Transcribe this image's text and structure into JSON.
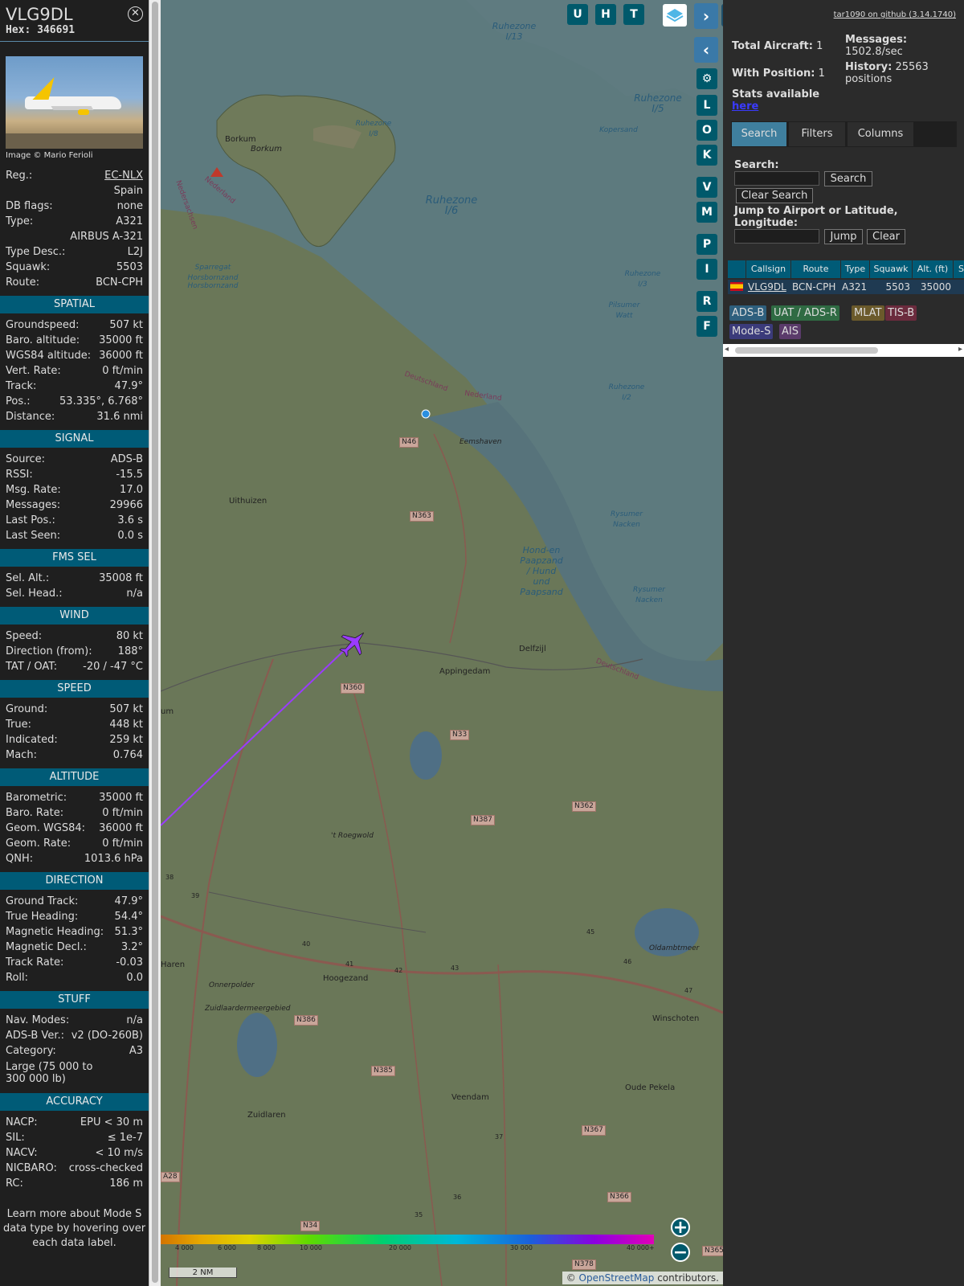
{
  "aircraft": {
    "callsign": "VLG9DL",
    "hex_label": "Hex: 346691",
    "close_glyph": "⊗",
    "image_credit": "Image © Mario Ferioli",
    "rows": [
      {
        "label": "Reg.:",
        "value": "EC-NLX",
        "sub": "Spain"
      },
      {
        "label": "DB flags:",
        "value": "none"
      },
      {
        "label": "Type:",
        "value": "A321",
        "sub": "AIRBUS A-321"
      },
      {
        "label": "Type Desc.:",
        "value": "L2J"
      },
      {
        "label": "Squawk:",
        "value": "5503"
      },
      {
        "label": "Route:",
        "value": "BCN-CPH"
      }
    ]
  },
  "sections": [
    {
      "title": "SPATIAL",
      "rows": [
        {
          "label": "Groundspeed:",
          "value": "507 kt"
        },
        {
          "label": "Baro. altitude:",
          "value": "35000 ft"
        },
        {
          "label": "WGS84 altitude:",
          "value": "36000 ft"
        },
        {
          "label": "Vert. Rate:",
          "value": "0 ft/min"
        },
        {
          "label": "Track:",
          "value": "47.9°"
        },
        {
          "label": "Pos.:",
          "value": "53.335°, 6.768°"
        },
        {
          "label": "Distance:",
          "value": "31.6 nmi"
        }
      ]
    },
    {
      "title": "SIGNAL",
      "rows": [
        {
          "label": "Source:",
          "value": "ADS-B"
        },
        {
          "label": "RSSI:",
          "value": "-15.5"
        },
        {
          "label": "Msg. Rate:",
          "value": "17.0"
        },
        {
          "label": "Messages:",
          "value": "29966"
        },
        {
          "label": "Last Pos.:",
          "value": "3.6 s"
        },
        {
          "label": "Last Seen:",
          "value": "0.0 s"
        }
      ]
    },
    {
      "title": "FMS SEL",
      "rows": [
        {
          "label": "Sel. Alt.:",
          "value": "35008 ft"
        },
        {
          "label": "Sel. Head.:",
          "value": "n/a"
        }
      ]
    },
    {
      "title": "WIND",
      "rows": [
        {
          "label": "Speed:",
          "value": "80 kt"
        },
        {
          "label": "Direction (from):",
          "value": "188°"
        },
        {
          "label": "TAT / OAT:",
          "value": "-20 / -47 °C"
        }
      ]
    },
    {
      "title": "SPEED",
      "rows": [
        {
          "label": "Ground:",
          "value": "507 kt"
        },
        {
          "label": "True:",
          "value": "448 kt"
        },
        {
          "label": "Indicated:",
          "value": "259 kt"
        },
        {
          "label": "Mach:",
          "value": "0.764"
        }
      ]
    },
    {
      "title": "ALTITUDE",
      "rows": [
        {
          "label": "Barometric:",
          "value": "35000 ft"
        },
        {
          "label": "Baro. Rate:",
          "value": "0 ft/min"
        },
        {
          "label": "Geom. WGS84:",
          "value": "36000 ft"
        },
        {
          "label": "Geom. Rate:",
          "value": "0 ft/min"
        },
        {
          "label": "QNH:",
          "value": "1013.6 hPa"
        }
      ]
    },
    {
      "title": "DIRECTION",
      "rows": [
        {
          "label": "Ground Track:",
          "value": "47.9°"
        },
        {
          "label": "True Heading:",
          "value": "54.4°"
        },
        {
          "label": "Magnetic Heading:",
          "value": "51.3°"
        },
        {
          "label": "Magnetic Decl.:",
          "value": "3.2°"
        },
        {
          "label": "Track Rate:",
          "value": "-0.03"
        },
        {
          "label": "Roll:",
          "value": "0.0"
        }
      ]
    },
    {
      "title": "STUFF",
      "rows": [
        {
          "label": "Nav. Modes:",
          "value": "n/a"
        },
        {
          "label": "ADS-B Ver.:",
          "value": "v2 (DO-260B)"
        },
        {
          "label": "Category:",
          "value": "A3"
        }
      ],
      "note": "Large (75 000 to 300 000 lb)"
    },
    {
      "title": "ACCURACY",
      "rows": [
        {
          "label": "NACP:",
          "value": "EPU < 30 m"
        },
        {
          "label": "SIL:",
          "value": "≤ 1e-7"
        },
        {
          "label": "NACV:",
          "value": "< 10 m/s"
        },
        {
          "label": "NICBARO:",
          "value": "cross-checked"
        },
        {
          "label": "RC:",
          "value": "186 m"
        }
      ]
    }
  ],
  "footer_text": "Learn more about Mode S data type by hovering over each data label.",
  "toolbar": {
    "top_buttons": [
      "U",
      "H",
      "T"
    ],
    "side_buttons": [
      "L",
      "O",
      "K",
      "V",
      "M",
      "P",
      "I",
      "R",
      "F"
    ],
    "nav_forward": "›",
    "nav_back": "‹",
    "toggle": "◂▸",
    "zoom_in": "+",
    "zoom_out": "−"
  },
  "map": {
    "places": [
      "Borkum",
      "Borkum",
      "Uithuizen",
      "Eemshaven",
      "Appingedam",
      "Delfzijl",
      "Hoogezand",
      "Haren",
      "Zuidlaren",
      "Veendam",
      "Winschoten",
      "Oude Pekela",
      "Oldambtmeer",
      "Onnerpolder",
      "Zuidlaardermeergebied",
      "'t Roegwold",
      "um"
    ],
    "sea_labels": [
      "Ruhezone I/6",
      "Ruhezone I/5",
      "Ruhezone I/13",
      "Ruhezone I/8",
      "Ruhezone I/3",
      "Ruhezone I/2",
      "Hond-en Paapzand / Hund und Paapsand",
      "Rysumer Nacken",
      "Rysumer Nacken",
      "Sparregat Horsbornzand",
      "Horsbornzand",
      "Pilsumer Watt",
      "Kopersand",
      "Deutschland",
      "Nederland",
      "Deutschland",
      "Nederland",
      "Nedersachsen"
    ],
    "roads": [
      "N46",
      "N363",
      "N360",
      "N33",
      "N387",
      "N362",
      "N386",
      "N385",
      "N367",
      "N366",
      "N378",
      "N34",
      "N365",
      "A28"
    ],
    "motorway_exits": [
      "40",
      "41",
      "42",
      "43",
      "45",
      "46",
      "47",
      "39",
      "38",
      "37",
      "36",
      "35"
    ],
    "color_scale_ticks": [
      "4 000",
      "6 000",
      "8 000",
      "10 000",
      "20 000",
      "30 000",
      "40 000+"
    ],
    "scale_bar": "2 NM",
    "attribution_prefix": "© ",
    "attribution_link": "OpenStreetMap",
    "attribution_suffix": " contributors."
  },
  "side": {
    "github": "tar1090 on github (3.14.1740)",
    "total_aircraft_label": "Total Aircraft:",
    "total_aircraft_value": "1",
    "with_position_label": "With Position:",
    "with_position_value": "1",
    "messages_label": "Messages:",
    "messages_value": "1502.8/sec",
    "history_label": "History:",
    "history_value": "25563",
    "history_unit": "positions",
    "stats_label": "Stats available",
    "stats_link": "here",
    "tabs": [
      "Search",
      "Filters",
      "Columns"
    ],
    "search_label": "Search:",
    "search_button": "Search",
    "clear_search_button": "Clear Search",
    "jump_label": "Jump to Airport or Latitude, Longitude:",
    "jump_button": "Jump",
    "clear_button": "Clear",
    "table_headers": [
      "Callsign",
      "Route",
      "Type",
      "Squawk",
      "Alt. (ft)",
      "S"
    ],
    "table_row": {
      "callsign": "VLG9DL",
      "route": "BCN-CPH",
      "type": "A321",
      "squawk": "5503",
      "alt": "35000"
    },
    "source_tags": [
      {
        "label": "ADS-B",
        "color": "#2e5f7d"
      },
      {
        "label": "UAT / ADS-R",
        "color": "#2f6b43"
      },
      {
        "label": "MLAT",
        "color": "#6b5a2b"
      },
      {
        "label": "TIS-B",
        "color": "#6b2b3d"
      },
      {
        "label": "Mode-S",
        "color": "#3b3b7a"
      },
      {
        "label": "AIS",
        "color": "#5b3b6b"
      }
    ]
  },
  "colors": {
    "accent": "#005b77",
    "panel": "#1f1f1f",
    "track": "#9a3bff"
  }
}
